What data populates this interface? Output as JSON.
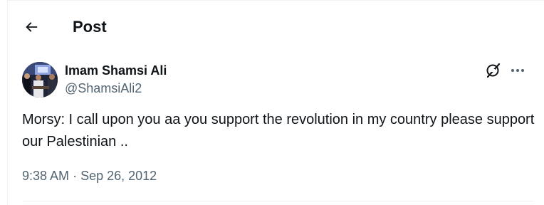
{
  "header": {
    "title": "Post"
  },
  "post": {
    "author_name": "Imam Shamsi Ali",
    "author_handle": "@ShamsiAli2",
    "text": "Morsy: I call upon you aa you support the revolution in my country please support our Palestinian ..",
    "time": "9:38 AM",
    "separator": "·",
    "date": "Sep 26, 2012"
  },
  "icons": {
    "back": "arrow-left-icon",
    "grok": "grok-icon",
    "more": "more-horizontal-icon"
  },
  "colors": {
    "text_primary": "#0f1419",
    "text_secondary": "#536471",
    "border": "#eff3f4"
  }
}
